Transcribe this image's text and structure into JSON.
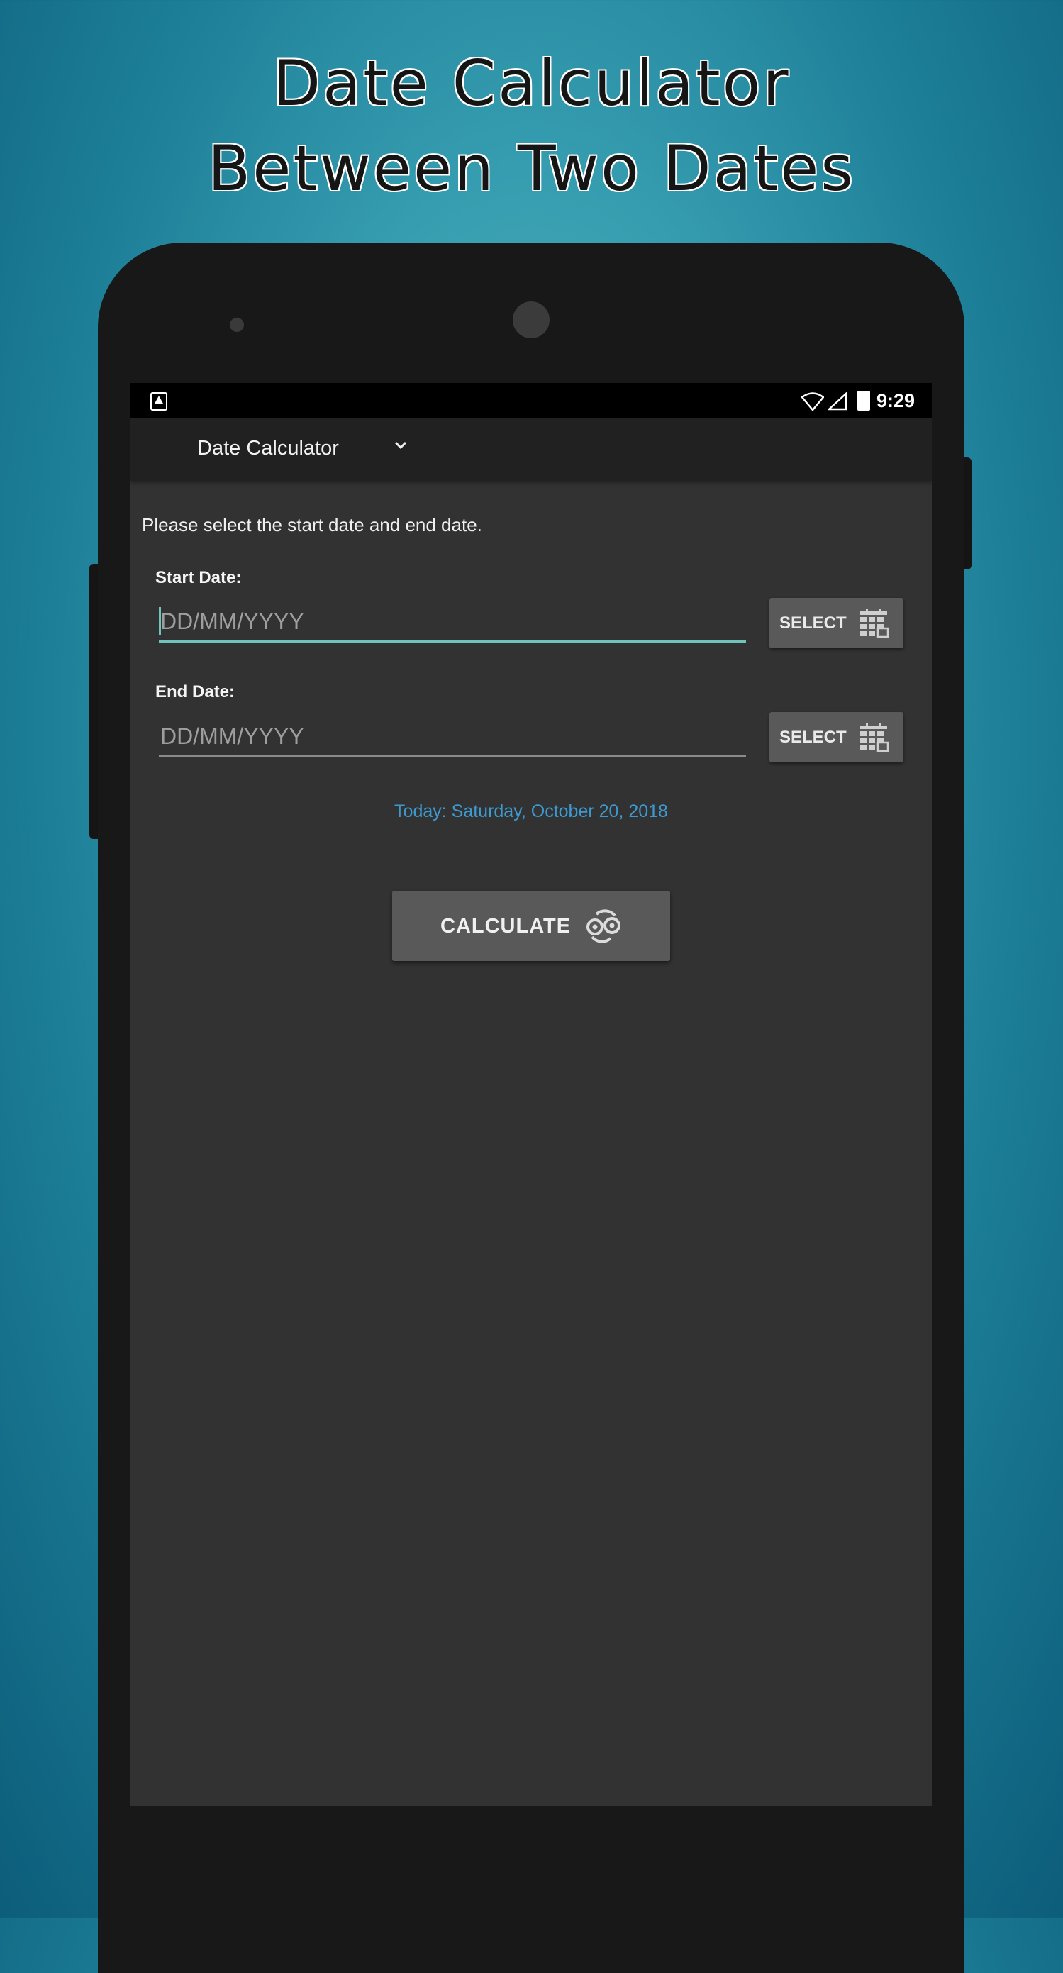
{
  "headline": {
    "line1": "Date Calculator",
    "line2": "Between Two Dates"
  },
  "statusbar": {
    "time": "9:29",
    "icons": [
      "app-notification-icon",
      "wifi-icon",
      "cell-signal-icon",
      "battery-charging-icon"
    ]
  },
  "toolbar": {
    "title": "Date Calculator",
    "dropdown_icon": "chevron-down-icon"
  },
  "form": {
    "instruction": "Please select the start date and end date.",
    "start": {
      "label": "Start Date:",
      "placeholder": "DD/MM/YYYY",
      "value": "",
      "button": "SELECT"
    },
    "end": {
      "label": "End Date:",
      "placeholder": "DD/MM/YYYY",
      "value": "",
      "button": "SELECT"
    },
    "today": "Today: Saturday, October 20, 2018",
    "calculate": "CALCULATE"
  },
  "colors": {
    "accent": "#6fc4bb",
    "today_text": "#3d9ad1",
    "screen_bg": "#323232",
    "toolbar_bg": "#212121",
    "button_bg": "#595959"
  }
}
